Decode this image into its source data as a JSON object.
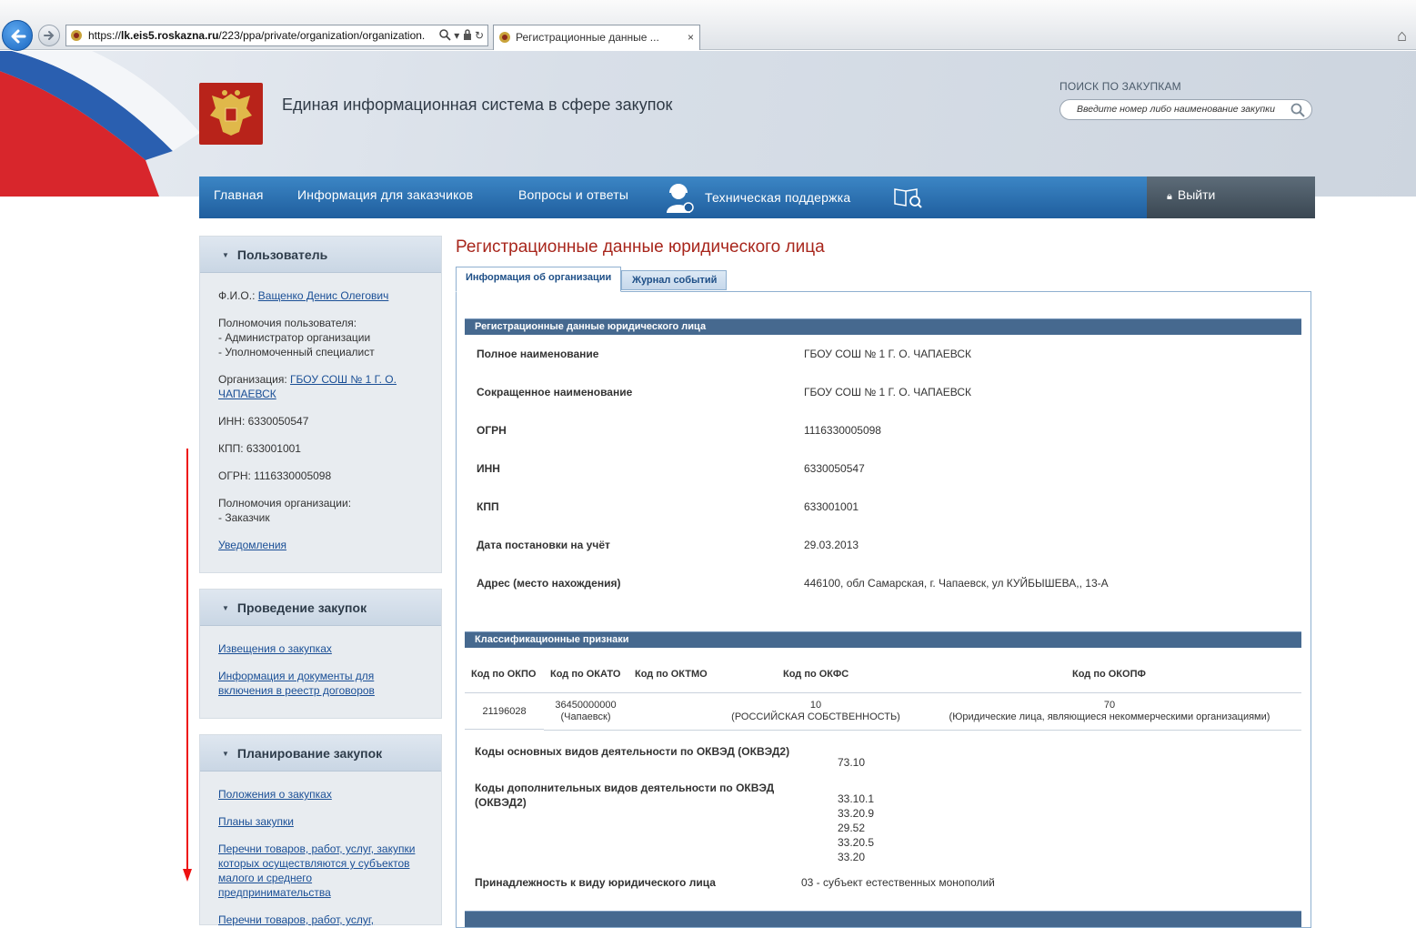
{
  "browser": {
    "url": "https://lk.eis5.roskazna.ru/223/ppa/private/organization/organization.",
    "url_host": "lk.eis5.roskazna.ru",
    "url_prefix": "https://",
    "url_path": "/223/ppa/private/organization/organization.",
    "tab_title": "Регистрационные данные ...",
    "tab_close": "×"
  },
  "header": {
    "site_title": "Единая информационная система в сфере закупок",
    "search_label": "ПОИСК ПО ЗАКУПКАМ",
    "search_placeholder": "Введите номер либо наименование закупки"
  },
  "nav": {
    "items": [
      "Главная",
      "Информация для заказчиков",
      "Вопросы и ответы",
      "Техническая поддержка"
    ],
    "logout": "Выйти"
  },
  "sidebar": {
    "user_panel": {
      "title": "Пользователь",
      "fio_label": "Ф.И.О.: ",
      "fio_value": "Ващенко Денис Олегович",
      "rights_label": "Полномочия пользователя:",
      "rights": [
        "- Администратор организации",
        "- Уполномоченный специалист"
      ],
      "org_label": "Организация: ",
      "org_value_1": "ГБОУ СОШ № 1 Г. О.",
      "org_value_2": "ЧАПАЕВСК",
      "inn": "ИНН: 6330050547",
      "kpp": "КПП: 633001001",
      "ogrn": "ОГРН: 1116330005098",
      "org_rights_label": "Полномочия организации:",
      "org_rights": "- Заказчик",
      "notifications": "Уведомления"
    },
    "procurement_panel": {
      "title": "Проведение закупок",
      "links": [
        "Извещения о закупках",
        "Информация и документы для",
        "включения в реестр договоров"
      ]
    },
    "planning_panel": {
      "title": "Планирование закупок",
      "links": [
        "Положения о закупках",
        "Планы закупки",
        "Перечни товаров, работ, услуг, закупки",
        "которых осуществляются у субъектов",
        "малого и среднего предпринимательства",
        "Перечни товаров, работ, услуг,"
      ]
    }
  },
  "main": {
    "page_title": "Регистрационные данные юридического лица",
    "tabs": [
      "Информация об организации",
      "Журнал событий"
    ],
    "reg_section_title": "Регистрационные данные юридического лица",
    "reg_rows": [
      {
        "label": "Полное наименование",
        "value": "ГБОУ СОШ № 1 Г. О. ЧАПАЕВСК"
      },
      {
        "label": "Сокращенное наименование",
        "value": "ГБОУ СОШ № 1 Г. О. ЧАПАЕВСК"
      },
      {
        "label": "ОГРН",
        "value": "1116330005098"
      },
      {
        "label": "ИНН",
        "value": "6330050547"
      },
      {
        "label": "КПП",
        "value": "633001001"
      },
      {
        "label": "Дата постановки на учёт",
        "value": "29.03.2013"
      },
      {
        "label": "Адрес (место нахождения)",
        "value": "446100, обл Самарская, г. Чапаевск, ул КУЙБЫШЕВА,, 13-А"
      }
    ],
    "class_section_title": "Классификационные признаки",
    "class_headers": [
      "Код по ОКПО",
      "Код по ОКАТО",
      "Код по ОКТМО",
      "Код по ОКФС",
      "Код по ОКОПФ"
    ],
    "class_values": {
      "okpo": "21196028",
      "okato_code": "36450000000",
      "okato_name": "(Чапаевск)",
      "oktmo": "",
      "okfs_code": "10",
      "okfs_name": "(РОССИЙСКАЯ СОБСТВЕННОСТЬ)",
      "okopf_code": "70",
      "okopf_name": "(Юридические лица, являющиеся некоммерческими организациями)"
    },
    "okved_main_label": "Коды основных видов деятельности по ОКВЭД (ОКВЭД2)",
    "okved_main": [
      "73.10"
    ],
    "okved_extra_label_1": "Коды дополнительных видов деятельности по ОКВЭД",
    "okved_extra_label_2": "(ОКВЭД2)",
    "okved_extra": [
      "33.10.1",
      "33.20.9",
      "29.52",
      "33.20.5",
      "33.20"
    ],
    "legal_type_label": "Принадлежность к виду юридического лица",
    "legal_type_value": "03 - субъект естественных монополий"
  }
}
